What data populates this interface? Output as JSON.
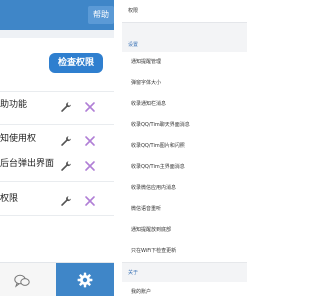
{
  "left": {
    "help_label": "帮助",
    "check_permissions_label": "检查权限",
    "permissions": [
      {
        "label": "助功能"
      },
      {
        "label": "知使用权"
      },
      {
        "label": "后台弹出界面"
      },
      {
        "label": "权限"
      }
    ],
    "icons": {
      "wrench": "wrench-icon",
      "remove": "close-icon",
      "chat": "chat-icon",
      "settings": "gear-icon"
    },
    "colors": {
      "accent": "#3f86c8",
      "button": "#2f7fcf",
      "remove": "#b07fd6"
    }
  },
  "right": {
    "top_label": "权限",
    "settings_header": "设置",
    "settings_items": [
      {
        "label": "通知提醒管理"
      },
      {
        "label": "弹窗字体大小"
      },
      {
        "label": "收录通知栏消息"
      },
      {
        "label": "收录QQ/Tim聊天界面消息"
      },
      {
        "label": "收录QQ/Tim图片和闪照"
      },
      {
        "label": "收录QQ/Tim主界面消息"
      },
      {
        "label": "收录微信应用内消息"
      },
      {
        "label": "微信语音重听"
      },
      {
        "label": "通知提醒放到底部"
      },
      {
        "label": "只在WiFi下检查更新"
      }
    ],
    "about_header": "关于",
    "about_items": [
      {
        "label": "我的账户"
      }
    ]
  }
}
